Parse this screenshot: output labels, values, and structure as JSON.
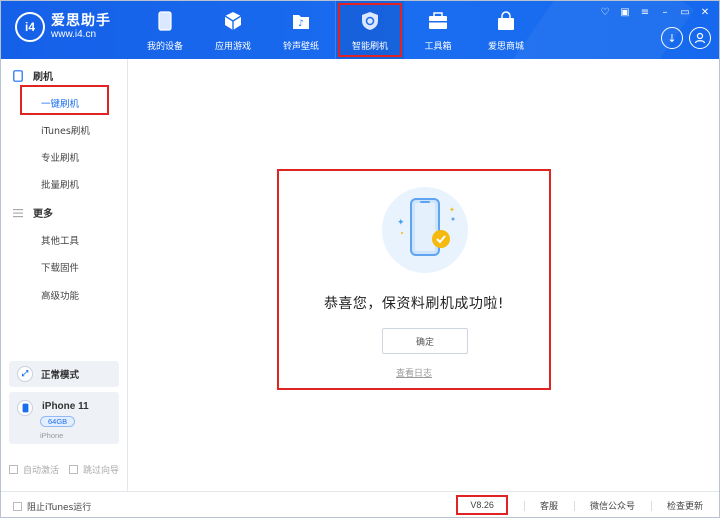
{
  "app": {
    "name": "爱思助手",
    "url": "www.i4.cn",
    "logo_mark": "i4"
  },
  "nav": {
    "items": [
      {
        "label": "我的设备",
        "icon": "phone-icon"
      },
      {
        "label": "应用游戏",
        "icon": "cube-icon"
      },
      {
        "label": "铃声壁纸",
        "icon": "music-folder-icon"
      },
      {
        "label": "智能刷机",
        "icon": "shield-refresh-icon",
        "active": true
      },
      {
        "label": "工具箱",
        "icon": "toolbox-icon"
      },
      {
        "label": "爱思商城",
        "icon": "shopping-bag-icon"
      }
    ]
  },
  "window_controls": [
    "shirt-icon",
    "note-icon",
    "menu-icon",
    "minimize-icon",
    "maximize-icon",
    "close-icon"
  ],
  "sidebar": {
    "sections": [
      {
        "title": "刷机",
        "icon": "tablet-icon",
        "items": [
          "一键刷机",
          "iTunes刷机",
          "专业刷机",
          "批量刷机"
        ]
      },
      {
        "title": "更多",
        "icon": "list-icon",
        "items": [
          "其他工具",
          "下载固件",
          "高级功能"
        ]
      }
    ],
    "active_item": "一键刷机",
    "mode": "正常模式",
    "device": {
      "name": "iPhone 11",
      "capacity": "64GB",
      "type": "iPhone"
    },
    "options": [
      {
        "label": "自动激活",
        "checked": false
      },
      {
        "label": "跳过向导",
        "checked": false
      }
    ]
  },
  "main": {
    "success_message": "恭喜您，保资料刷机成功啦!",
    "ok_button": "确定",
    "view_log_link": "查看日志"
  },
  "footer": {
    "block_itunes": {
      "label": "阻止iTunes运行",
      "checked": false
    },
    "version": "V8.26",
    "links": [
      "客服",
      "微信公众号",
      "检查更新"
    ]
  },
  "colors": {
    "brand_blue": "#1a6df0",
    "highlight_red": "#e02424",
    "success_yellow": "#f5b90f"
  }
}
